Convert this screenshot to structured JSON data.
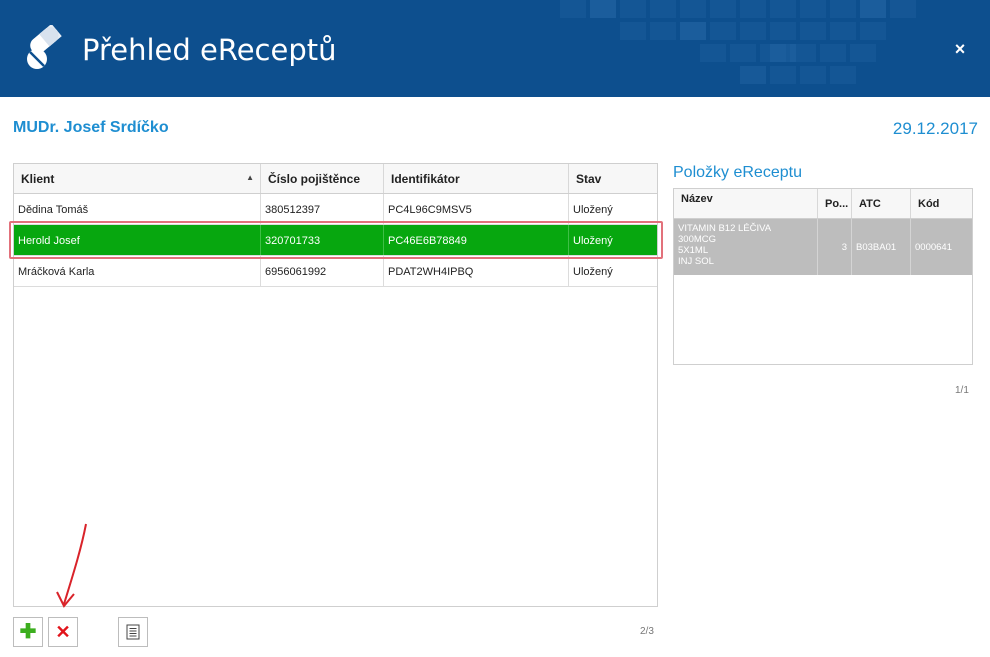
{
  "header": {
    "title": "Přehled eReceptů",
    "close_label": "×"
  },
  "doctor_name": "MUDr. Josef Srdíčko",
  "date": "29.12.2017",
  "prescriptions_table": {
    "columns": [
      "Klient",
      "Číslo pojištěnce",
      "Identifikátor",
      "Stav"
    ],
    "sort_indicator": "▲",
    "rows": [
      {
        "client": "Dědina Tomáš",
        "insurance_no": "380512397",
        "identifier": "PC4L96C9MSV5",
        "status": "Uložený"
      },
      {
        "client": "Herold Josef",
        "insurance_no": "320701733",
        "identifier": "PC46E6B78849",
        "status": "Uložený"
      },
      {
        "client": "Mráčková Karla",
        "insurance_no": "6956061992",
        "identifier": "PDAT2WH4IPBQ",
        "status": "Uložený"
      }
    ],
    "selected_row_index": 1,
    "pager": "2/3"
  },
  "items_panel": {
    "title": "Položky eReceptu",
    "columns": [
      "Název",
      "Po...",
      "ATC",
      "Kód"
    ],
    "rows": [
      {
        "name_lines": [
          "VITAMIN B12 LÉČIVA",
          "300MCG",
          "5X1ML",
          "INJ SOL"
        ],
        "count": "3",
        "atc": "B03BA01",
        "code": "0000641"
      }
    ],
    "pager": "1/1"
  },
  "toolbar": {
    "add_icon": "plus-icon",
    "delete_icon": "close-icon",
    "document_icon": "document-icon"
  },
  "colors": {
    "header_bg": "#0d4f8e",
    "accent_blue": "#1e8ed1",
    "selected_row": "#07a70f",
    "highlight_border": "#e2717b",
    "add_green": "#3cae1e",
    "delete_red": "#e2141b"
  }
}
